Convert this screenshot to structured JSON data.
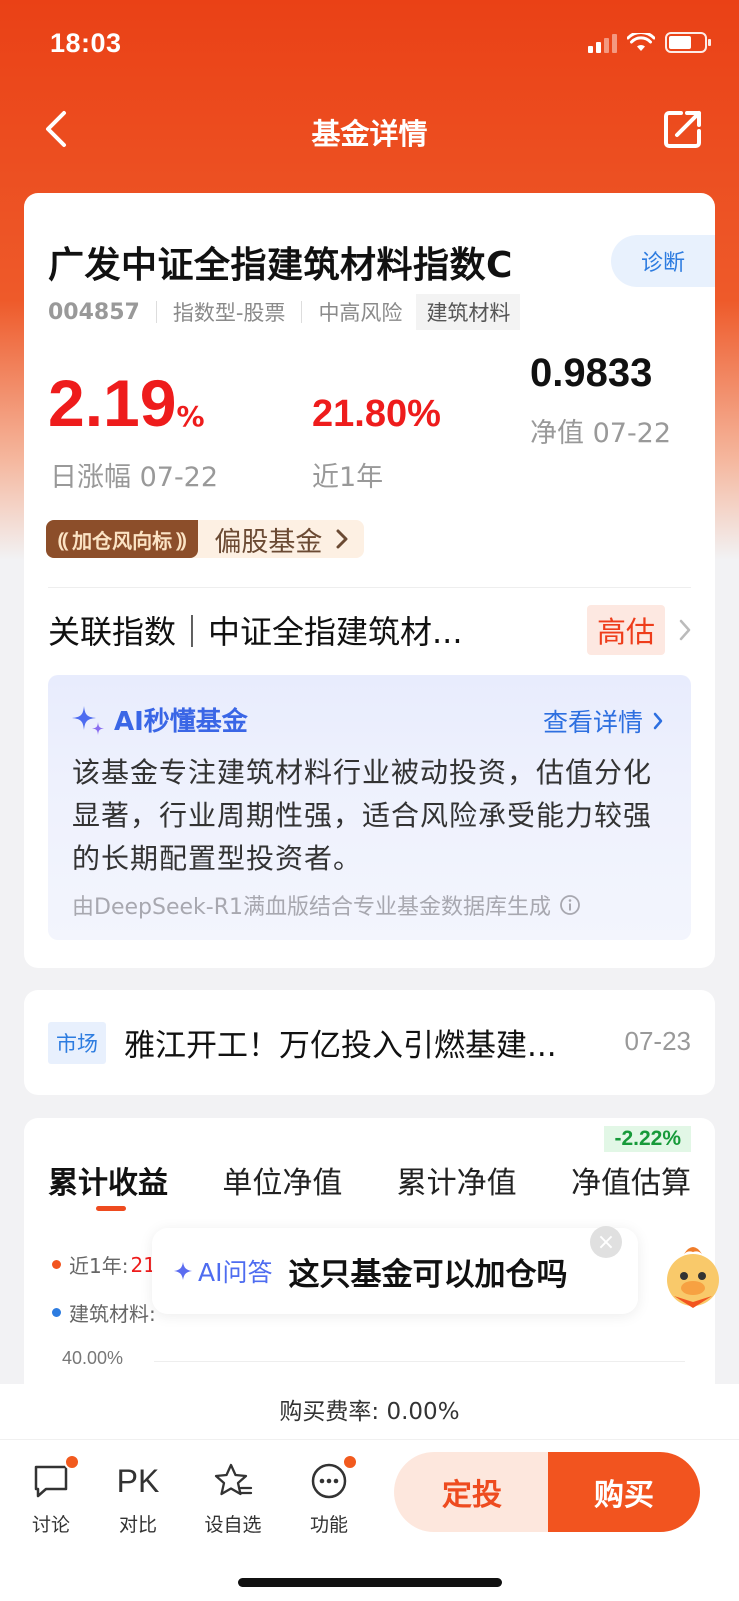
{
  "status": {
    "time": "18:03"
  },
  "nav": {
    "title": "基金详情",
    "back_icon": "chevron-left-icon",
    "share_icon": "share-icon"
  },
  "fund": {
    "name": "广发中证全指建筑材料指数C",
    "diagnose_label": "诊断",
    "code": "004857",
    "type": "指数型-股票",
    "risk": "中高风险",
    "sector": "建筑材料",
    "daily_change": "2.19",
    "daily_change_unit": "%",
    "daily_change_label": "日涨幅 07-22",
    "one_year_return": "21.80%",
    "one_year_label": "近1年",
    "nav_value": "0.9833",
    "nav_label": "净值 07-22",
    "badge_dark": "加仓风向标",
    "badge_light": "偏股基金",
    "related_index": "关联指数｜中证全指建筑材...",
    "valuation": "高估"
  },
  "ai_summary": {
    "title": "AI秒懂基金",
    "more_label": "查看详情",
    "body": "该基金专注建筑材料行业被动投资，估值分化显著，行业周期性强，适合风险承受能力较强的长期配置型投资者。",
    "footer": "由DeepSeek-R1满血版结合专业基金数据库生成"
  },
  "news": {
    "tag": "市场",
    "title": "雅江开工！万亿投入引燃基建...",
    "date": "07-23"
  },
  "chart_tabs": {
    "tabs": [
      "累计收益",
      "单位净值",
      "累计净值",
      "净值估算"
    ],
    "estimate_badge": "-2.22%",
    "legend1_label": "近1年:",
    "legend1_value": "21",
    "legend2_label": "建筑材料:",
    "y_tick": "40.00%",
    "colors": {
      "series1": "#f2541f",
      "series2": "#2d7ce0"
    }
  },
  "ai_popup": {
    "label": "AI问答",
    "question": "这只基金可以加仓吗",
    "close_icon": "close-icon"
  },
  "fee": {
    "text": "购买费率: 0.00%"
  },
  "bottom_bar": {
    "discuss": "讨论",
    "pk_icon_text": "PK",
    "compare": "对比",
    "watchlist": "设自选",
    "functions": "功能",
    "plan_button": "定投",
    "buy_button": "购买"
  },
  "colors": {
    "brand": "#ea4116",
    "rise": "#ee1c1c",
    "link": "#2d7ce0"
  }
}
